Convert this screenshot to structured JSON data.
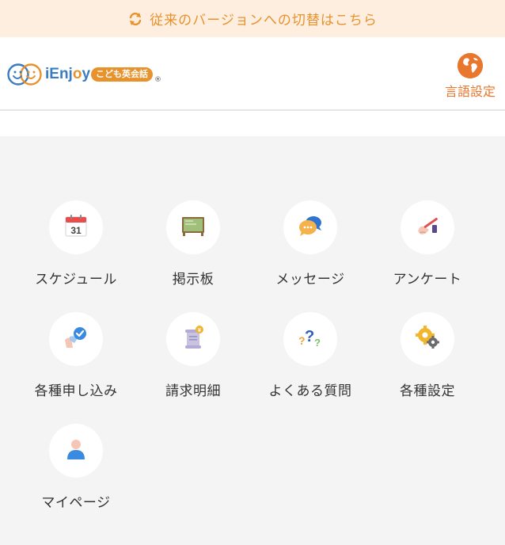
{
  "version_bar": {
    "label": "従来のバージョンへの切替はこちら"
  },
  "header": {
    "logo_brand_prefix": "iEnj",
    "logo_brand_o": "o",
    "logo_brand_suffix": "y",
    "logo_tag": "こども英会話",
    "logo_reg": "®",
    "language_label": "言語設定"
  },
  "menu": {
    "items": [
      {
        "label": "スケジュール",
        "icon": "calendar-icon"
      },
      {
        "label": "掲示板",
        "icon": "bulletin-board-icon"
      },
      {
        "label": "メッセージ",
        "icon": "chat-bubbles-icon"
      },
      {
        "label": "アンケート",
        "icon": "survey-pen-icon"
      },
      {
        "label": "各種申し込み",
        "icon": "application-check-icon"
      },
      {
        "label": "請求明細",
        "icon": "invoice-scroll-icon"
      },
      {
        "label": "よくある質問",
        "icon": "question-marks-icon"
      },
      {
        "label": "各種設定",
        "icon": "gear-settings-icon"
      },
      {
        "label": "マイページ",
        "icon": "user-profile-icon"
      }
    ],
    "calendar_day": "31"
  },
  "colors": {
    "accent_orange": "#e8922c",
    "brand_blue": "#3a7cc1",
    "banner_bg": "#fdeee0",
    "page_bg": "#f4f4f4"
  }
}
